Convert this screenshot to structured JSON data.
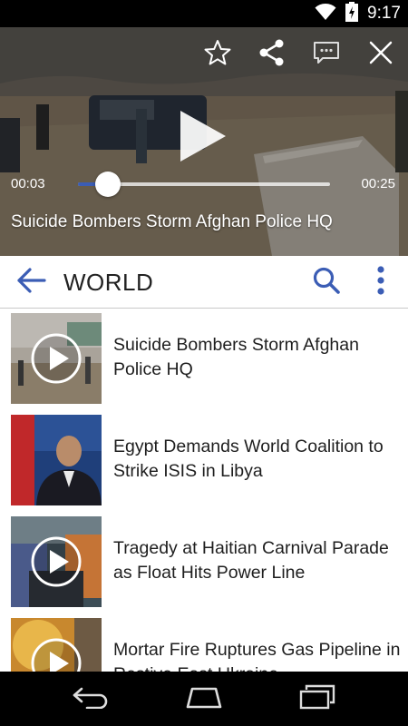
{
  "status_bar": {
    "time": "9:17",
    "icons": [
      "wifi-icon",
      "battery-charging-icon"
    ]
  },
  "player": {
    "current_time": "00:03",
    "duration": "00:25",
    "progress": 0.12,
    "title": "Suicide Bombers Storm Afghan Police HQ",
    "actions": [
      "star-icon",
      "share-icon",
      "comment-icon",
      "close-icon"
    ]
  },
  "app_bar": {
    "title": "WORLD",
    "actions": [
      "search-icon",
      "overflow-menu-icon"
    ]
  },
  "articles": [
    {
      "headline": "Suicide Bombers Storm Afghan Police HQ",
      "has_video": true
    },
    {
      "headline": "Egypt Demands World Coalition to Strike ISIS in Libya",
      "has_video": false
    },
    {
      "headline": "Tragedy at Haitian Carnival Parade as Float Hits Power Line",
      "has_video": true
    },
    {
      "headline": "Mortar Fire Ruptures Gas Pipeline in Restive East Ukraine",
      "has_video": true
    }
  ],
  "colors": {
    "accent": "#3b5db5",
    "text": "#1e1e1e"
  }
}
